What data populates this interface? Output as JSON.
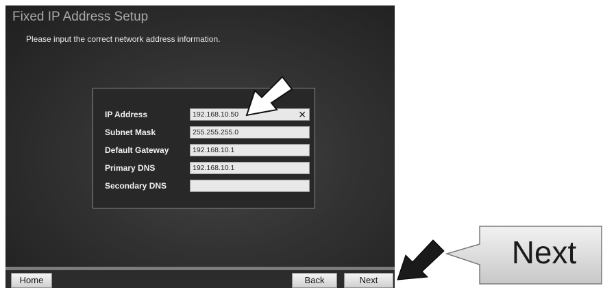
{
  "window": {
    "title": "Fixed IP Address Setup",
    "subtitle": "Please input the correct network address information."
  },
  "form": {
    "fields": [
      {
        "label": "IP Address",
        "value": "192.168.10.50"
      },
      {
        "label": "Subnet Mask",
        "value": "255.255.255.0"
      },
      {
        "label": "Default Gateway",
        "value": "192.168.10.1"
      },
      {
        "label": "Primary DNS",
        "value": "192.168.10.1"
      },
      {
        "label": "Secondary DNS",
        "value": ""
      }
    ],
    "clear_glyph": "✕"
  },
  "footer": {
    "home_label": "Home",
    "back_label": "Back",
    "next_label": "Next"
  },
  "callout": {
    "text": "Next"
  },
  "icons": {
    "pointer_arrow": "arrow-icon",
    "clear": "close-icon"
  }
}
